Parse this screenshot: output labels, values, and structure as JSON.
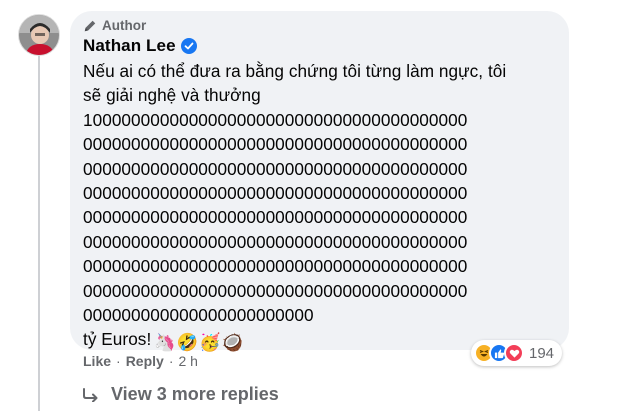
{
  "comment": {
    "author_badge": "Author",
    "author_name": "Nathan Lee",
    "text_lines": [
      "Nếu ai có thể đưa ra bằng chứng tôi từng làm ngực, tôi",
      "sẽ giải nghệ và thưởng",
      "1000000000000000000000000000000000000000",
      "0000000000000000000000000000000000000000",
      "0000000000000000000000000000000000000000",
      "0000000000000000000000000000000000000000",
      "0000000000000000000000000000000000000000",
      "0000000000000000000000000000000000000000",
      "0000000000000000000000000000000000000000",
      "0000000000000000000000000000000000000000",
      "000000000000000000000000"
    ],
    "last_line_text": "tỷ Euros!",
    "emojis": [
      "🦄",
      "🤣",
      "🥳",
      "🥥"
    ]
  },
  "actions": {
    "like_label": "Like",
    "separator": "·",
    "reply_label": "Reply",
    "time": "2 h"
  },
  "reactions": {
    "types": [
      "haha",
      "like",
      "love"
    ],
    "count": "194",
    "colors": {
      "haha": "#f7b125",
      "like": "#1877f2",
      "love": "#f33e58"
    }
  },
  "replies": {
    "label": "View 3 more replies"
  }
}
